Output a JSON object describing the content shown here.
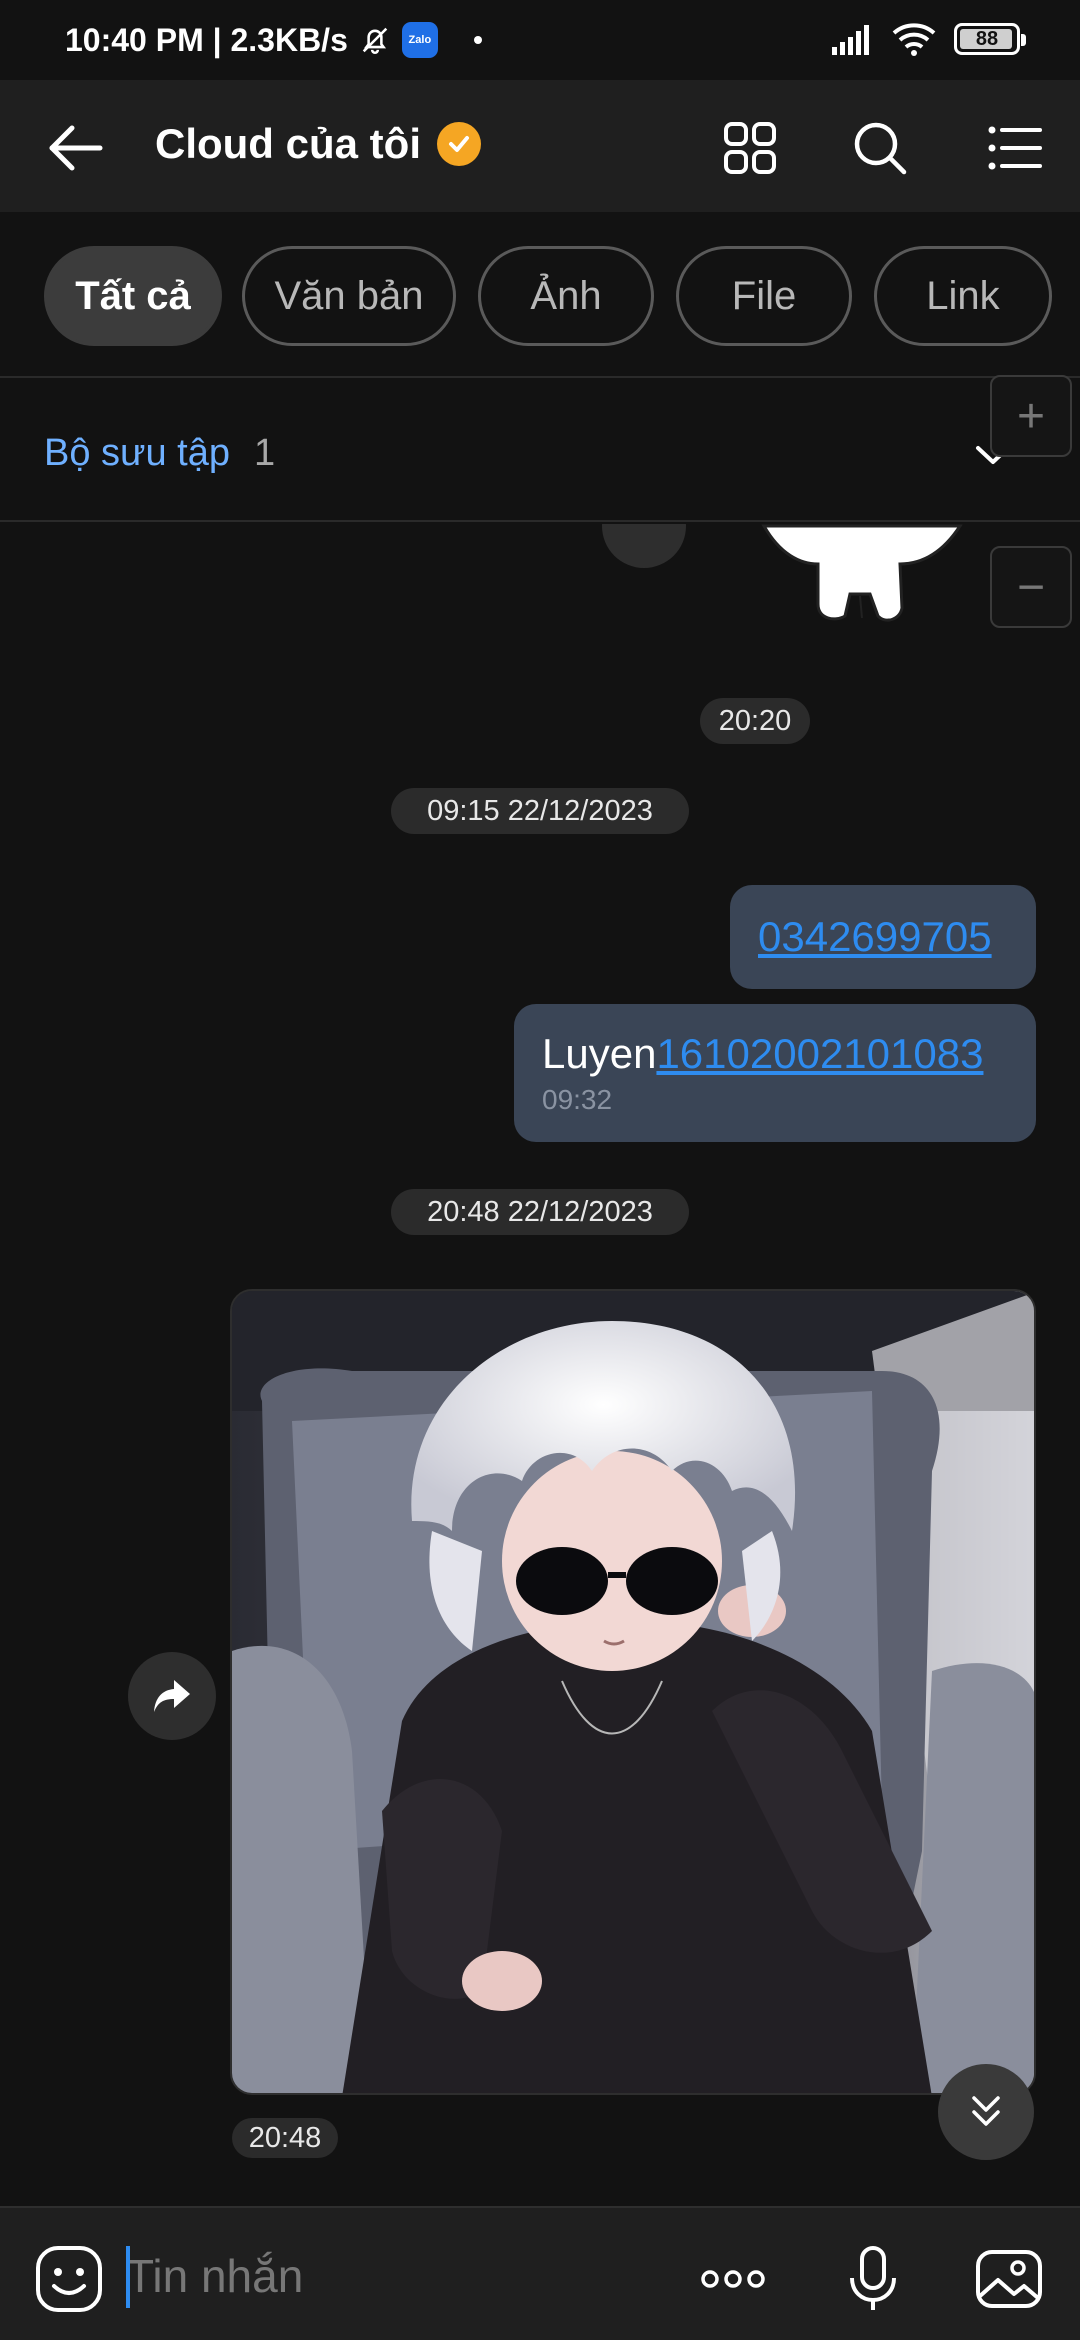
{
  "status_bar": {
    "time_speed": "10:40 PM | 2.3KB/s",
    "zalo_label": "Zalo",
    "battery": "88",
    "battery_level": 0.88
  },
  "header": {
    "title": "Cloud của tôi",
    "icons": [
      "back-arrow-icon",
      "grid-icon",
      "search-icon",
      "list-menu-icon"
    ]
  },
  "filters": [
    "Tất cả",
    "Văn bản",
    "Ảnh",
    "File",
    "Link"
  ],
  "collection": {
    "label": "Bộ sưu tập",
    "count": "1"
  },
  "side_buttons": {
    "plus": "+",
    "minus": "−"
  },
  "chat": {
    "time_1": "20:20",
    "date_1": "09:15 22/12/2023",
    "msg_1_link": "0342699705",
    "msg_2_text": "Luyen",
    "msg_2_link": "16102002101083",
    "msg_2_time": "09:32",
    "date_2": "20:48 22/12/2023",
    "photo_time": "20:48"
  },
  "input": {
    "placeholder": "Tin nhắn"
  },
  "colors": {
    "background": "#121212",
    "header": "#1f1f1f",
    "accent": "#2e8cf0",
    "bubble": "#3a4556",
    "verified": "#f5a623"
  }
}
